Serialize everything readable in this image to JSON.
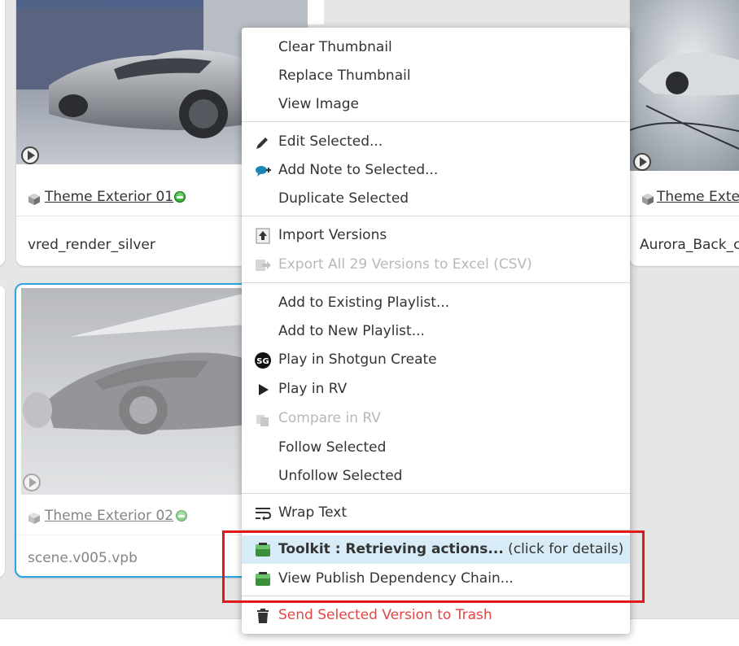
{
  "cards": [
    {
      "title": "Theme Exterior 01",
      "code": "vred_render_silver"
    },
    {
      "title": "Theme Exter",
      "code": "Aurora_Back_c"
    },
    {
      "title": "Theme Exterior 02",
      "code": "scene.v005.vpb"
    }
  ],
  "menu": {
    "clear_thumbnail": "Clear Thumbnail",
    "replace_thumbnail": "Replace Thumbnail",
    "view_image": "View Image",
    "edit_selected": "Edit Selected...",
    "add_note": "Add Note to Selected...",
    "duplicate_selected": "Duplicate Selected",
    "import_versions": "Import Versions",
    "export_versions": "Export All 29 Versions to Excel (CSV)",
    "add_existing_playlist": "Add to Existing Playlist...",
    "add_new_playlist": "Add to New Playlist...",
    "play_shotgun_create": "Play in Shotgun Create",
    "play_rv": "Play in RV",
    "compare_rv": "Compare in RV",
    "follow_selected": "Follow Selected",
    "unfollow_selected": "Unfollow Selected",
    "wrap_text": "Wrap Text",
    "toolkit_bold": "Toolkit : Retrieving actions...",
    "toolkit_rest": " (click for details)",
    "view_publish_chain": "View Publish Dependency Chain...",
    "send_trash": "Send Selected Version to Trash"
  },
  "colors": {
    "accent": "#2ea3e0",
    "danger": "#e04646",
    "highlight": "#d8ecf7",
    "annotation_box": "#e01a1a"
  }
}
